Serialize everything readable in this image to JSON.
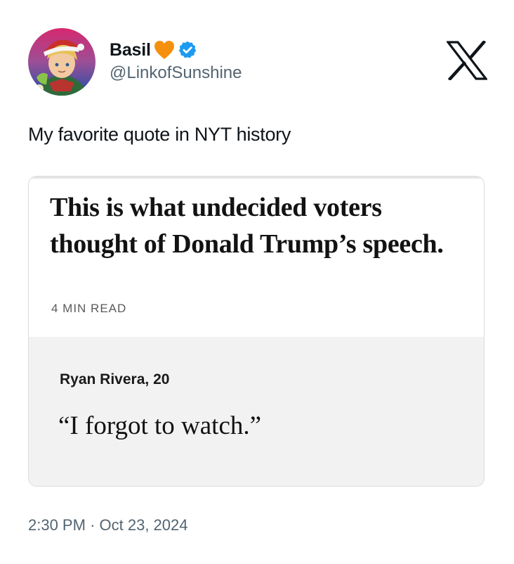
{
  "author": {
    "display_name": "Basil",
    "handle": "@LinkofSunshine",
    "name_emoji_icon": "orange-heart-icon",
    "badge_icon": "verified-badge-icon"
  },
  "brand": {
    "logo_icon": "x-logo-icon"
  },
  "tweet": {
    "text": "My favorite quote in NYT history",
    "time": "2:30 PM",
    "separator": "·",
    "date": "Oct 23, 2024"
  },
  "card": {
    "headline": "This is what undecided voters thought of Donald Trump’s speech.",
    "read_time": "4 MIN READ",
    "person": "Ryan Rivera, 20",
    "quote": "“I forgot to watch.”"
  },
  "colors": {
    "text": "#0f1419",
    "secondary_text": "#536471",
    "verified_blue": "#1d9bf0",
    "heart_orange": "#f4900c",
    "quote_background": "#f2f2f2"
  }
}
